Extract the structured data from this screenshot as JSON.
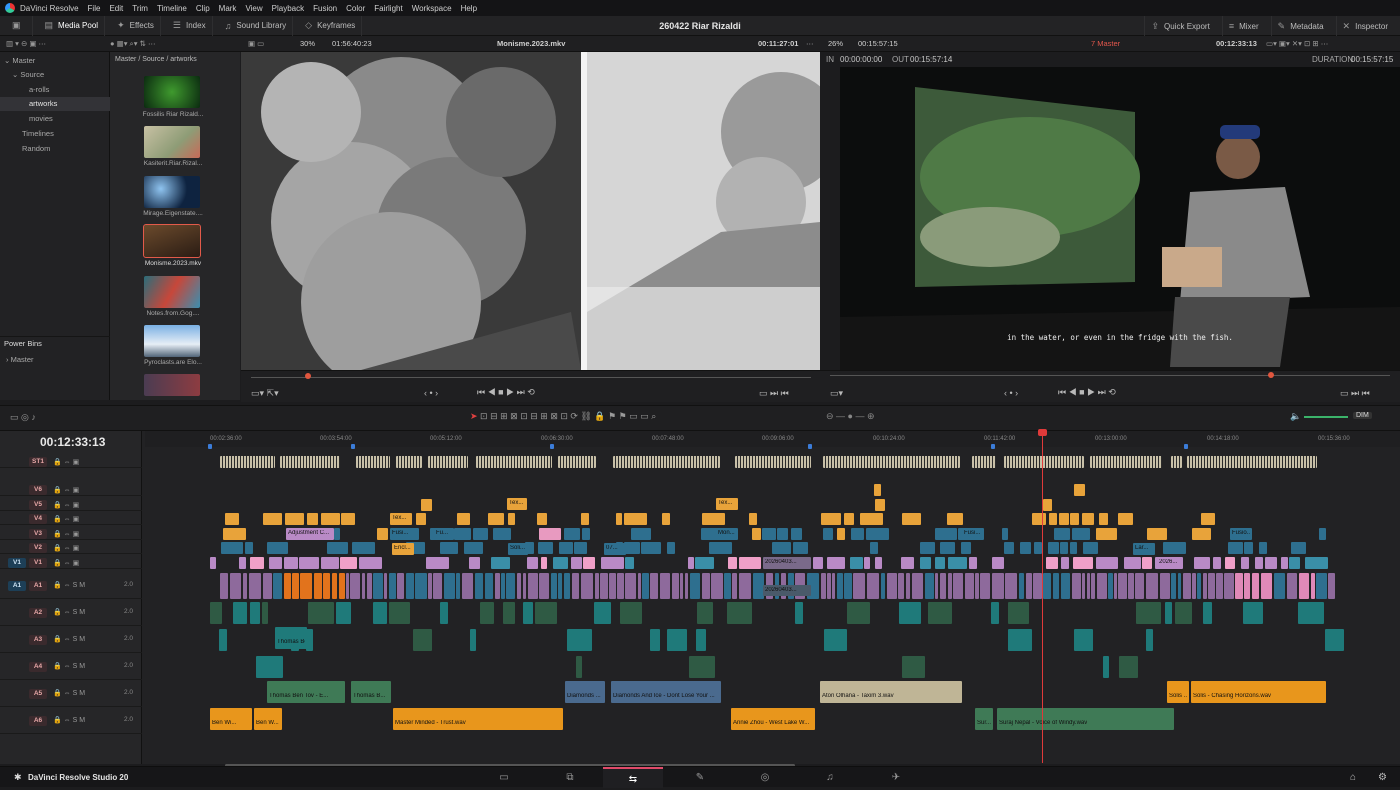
{
  "menu": {
    "app": "DaVinci Resolve",
    "items": [
      "File",
      "Edit",
      "Trim",
      "Timeline",
      "Clip",
      "Mark",
      "View",
      "Playback",
      "Fusion",
      "Color",
      "Fairlight",
      "Workspace",
      "Help"
    ]
  },
  "toolbar": {
    "media_pool": "Media Pool",
    "effects": "Effects",
    "index": "Index",
    "sound_library": "Sound Library",
    "keyframes": "Keyframes",
    "project": "260422 Riar Rizaldi",
    "quick_export": "Quick Export",
    "mixer": "Mixer",
    "metadata": "Metadata",
    "inspector": "Inspector"
  },
  "source_viewer": {
    "zoom": "30%",
    "tc_left": "01:56:40:23",
    "clip": "Monisme.2023.mkv",
    "tc_right": "00:11:27:01"
  },
  "timeline_viewer": {
    "zoom": "26%",
    "duration_tc": "00:15:57:15",
    "timeline": "7 Master",
    "tc": "00:12:33:13",
    "in_label": "IN",
    "in_tc": "00:00:00:00",
    "out_label": "OUT",
    "out_tc": "00:15:57:14",
    "duration_label": "DURATION",
    "duration_val": "00:15:57:15",
    "subtitle": "in the water, or even in the fridge with the fish."
  },
  "sidebar": {
    "master": "Master",
    "source": "Source",
    "items": [
      "a-rolls",
      "artworks",
      "movies"
    ],
    "timelines": "Timelines",
    "random": "Random",
    "power_bins": "Power Bins",
    "pb_master": "Master"
  },
  "mediapool": {
    "path": "Master / Source / artworks",
    "clips": [
      "Fossilis Riar Rizald...",
      "Kasiterit.Riar.Rizal...",
      "Mirage.Eigenstate....",
      "Monisme.2023.mkv",
      "Notes.from.Gog....",
      "Pyroclasts.are Elo..."
    ]
  },
  "timeline": {
    "timecode": "00:12:33:13",
    "ruler": [
      "00:02:36:00",
      "00:03:54:00",
      "00:05:12:00",
      "00:06:30:00",
      "00:07:48:00",
      "00:09:06:00",
      "00:10:24:00",
      "00:11:42:00",
      "00:13:00:00",
      "00:14:18:00",
      "00:15:36:00"
    ],
    "dim": "DIM",
    "tracks": [
      "ST1",
      "V6",
      "V5",
      "V4",
      "V3",
      "V2",
      "V1",
      "A1",
      "A2",
      "A3",
      "A4",
      "A5",
      "A6"
    ],
    "src_v": "V1",
    "src_a": "A1",
    "vol": "2.0",
    "audio_clips": [
      "Thomas Ben Tov - E...",
      "Thomas B...",
      "Diamonds ...",
      "Diamonds And Ice - Dont Lose Your ...",
      "Aton Olhana - Taxim 3.wav",
      "Solis ...",
      "Solis - Chasing Horizons.wav",
      "Ben Wi...",
      "Ben W...",
      "Master Minded - Trust.wav",
      "Annie Zhou - West Lake W...",
      "Sur...",
      "Suraj Nepal - Voice of Windy.wav"
    ],
    "video_labels": [
      "Adjustment C...",
      "Tex...",
      "Fusi...",
      "Tex...",
      "Encl...",
      "Fu...",
      "Soli...",
      "Mon...",
      "07...",
      "Tex...",
      "Fusi...",
      "Lar...",
      "Fusio...",
      "20260403...",
      "2026..."
    ]
  },
  "bottom": {
    "brand": "DaVinci Resolve Studio 20"
  }
}
